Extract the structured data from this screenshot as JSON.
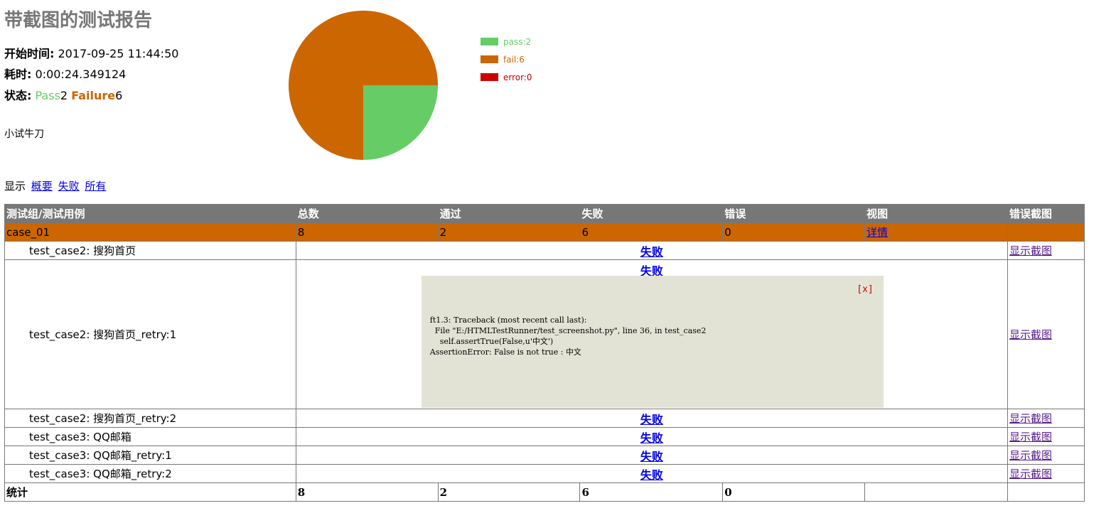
{
  "report": {
    "title": "带截图的测试报告",
    "start_label": "开始时间:",
    "start_value": "2017-09-25 11:44:50",
    "duration_label": "耗时:",
    "duration_value": "0:00:24.349124",
    "status_label": "状态:",
    "status_pass_word": "Pass",
    "status_pass_count": "2",
    "status_fail_word": "Failure",
    "status_fail_count": "6",
    "description": "小试牛刀"
  },
  "chart_data": {
    "type": "pie",
    "categories": [
      "pass",
      "fail",
      "error"
    ],
    "values": [
      2,
      6,
      0
    ],
    "colors": [
      "#66cc66",
      "#cc6600",
      "#cc0000"
    ],
    "legend": [
      "pass:2",
      "fail:6",
      "error:0"
    ],
    "legend_position": "right"
  },
  "filter": {
    "label": "显示",
    "summary": "概要",
    "failed": "失败",
    "all": "所有"
  },
  "table": {
    "headers": [
      "测试组/测试用例",
      "总数",
      "通过",
      "失败",
      "错误",
      "视图",
      "错误截图"
    ],
    "group": {
      "name": "case_01",
      "total": "8",
      "pass": "2",
      "fail": "6",
      "error": "0",
      "detail_link": "详情"
    },
    "cases": [
      {
        "name": "test_case2: 搜狗首页",
        "status": "失败",
        "screenshot": "显示截图"
      },
      {
        "name": "test_case2: 搜狗首页_retry:1",
        "status": "失败",
        "screenshot": "显示截图"
      },
      {
        "name": "test_case2: 搜狗首页_retry:2",
        "status": "失败",
        "screenshot": "显示截图"
      },
      {
        "name": "test_case3: QQ邮箱",
        "status": "失败",
        "screenshot": "显示截图"
      },
      {
        "name": "test_case3: QQ邮箱_retry:1",
        "status": "失败",
        "screenshot": "显示截图"
      },
      {
        "name": "test_case3: QQ邮箱_retry:2",
        "status": "失败",
        "screenshot": "显示截图"
      }
    ],
    "popup": {
      "close": "[x]",
      "traceback": "ft1.3: Traceback (most recent call last):\n  File \"E:/HTMLTestRunner/test_screenshot.py\", line 36, in test_case2\n    self.assertTrue(False,u'中文')\nAssertionError: False is not true : 中文"
    },
    "totals": {
      "label": "统计",
      "total": "8",
      "pass": "2",
      "fail": "6",
      "error": "0"
    }
  }
}
